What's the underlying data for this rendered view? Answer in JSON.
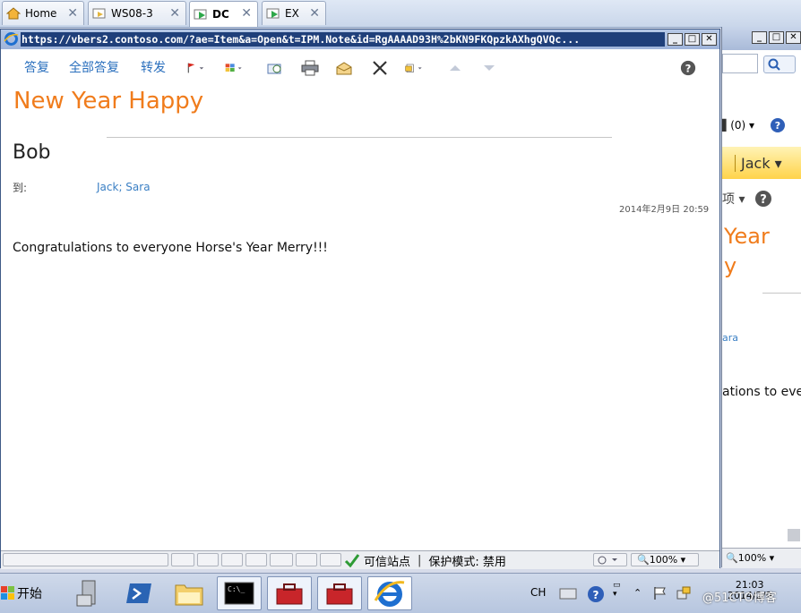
{
  "tabs": [
    {
      "label": "Home",
      "icon": "home-icon",
      "active": false
    },
    {
      "label": "WS08-3",
      "icon": "vm-icon",
      "active": false
    },
    {
      "label": "DC",
      "icon": "vm-play-icon",
      "active": true
    },
    {
      "label": "EX",
      "icon": "vm-play-icon",
      "active": false
    }
  ],
  "window": {
    "url": "https://vbers2.contoso.com/?ae=Item&a=Open&t=IPM.Note&id=RgAAAAD93H%2bKN9FKQpzkAXhgQVQc..."
  },
  "toolbar": {
    "reply": "答复",
    "reply_all": "全部答复",
    "forward": "转发"
  },
  "message": {
    "subject": "New Year Happy",
    "sender": "Bob",
    "to_label": "到:",
    "to_recipients": "Jack; Sara",
    "date": "2014年2月9日   20:59",
    "body": "Congratulations to everyone Horse's Year Merry!!!"
  },
  "background_window": {
    "menu_label": "(0)",
    "user": "Jack",
    "subject_fragment_1": "Year",
    "subject_fragment_2": "y",
    "recipient_fragment": "ara",
    "body_fragment": "ations to ever",
    "zoom": "100%"
  },
  "statusbar": {
    "trusted_zone": "可信站点",
    "protected_mode": "保护模式: 禁用",
    "zoom": "100%"
  },
  "taskbar": {
    "start_label": "开始",
    "lang": "CH",
    "time": "21:03",
    "date": "2014/2/9",
    "watermark": "@51CTO博客"
  },
  "colors": {
    "accent_orange": "#f07c1c",
    "link_blue": "#2a6fbd"
  }
}
